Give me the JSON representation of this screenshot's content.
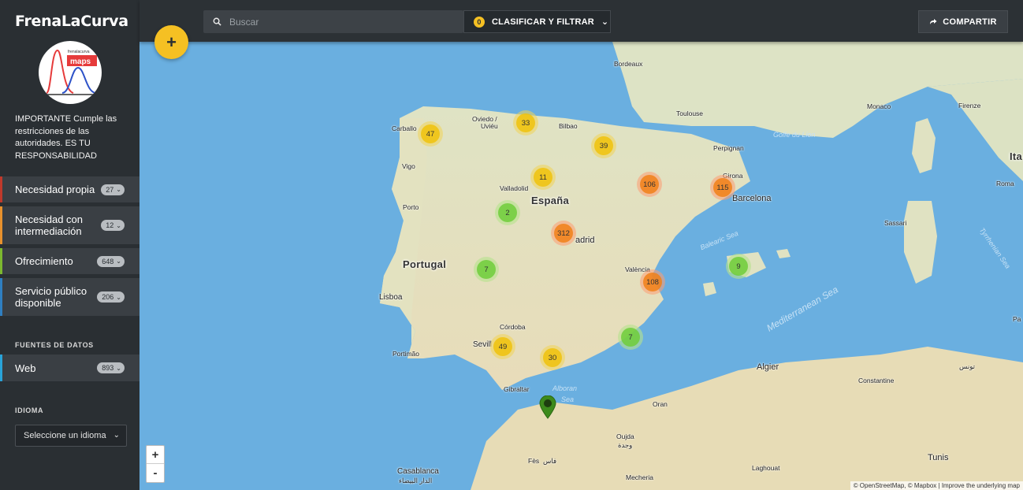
{
  "brand": "FrenaLaCurva",
  "logo": {
    "small_text": "frenalacurva",
    "big_text": "maps"
  },
  "notice": "IMPORTANTE Cumple las restricciones de las autoridades. ES TU RESPONSABILIDAD",
  "categories": [
    {
      "label": "Necesidad propia",
      "count": "27",
      "color": "#c0392b"
    },
    {
      "label": "Necesidad con intermediación",
      "count": "12",
      "color": "#e8912d"
    },
    {
      "label": "Ofrecimiento",
      "count": "648",
      "color": "#7cb82f"
    },
    {
      "label": "Servicio público disponible",
      "count": "206",
      "color": "#2f7fc1"
    }
  ],
  "sources": {
    "title": "FUENTES DE DATOS",
    "items": [
      {
        "label": "Web",
        "count": "893",
        "color": "#29a3d9"
      }
    ]
  },
  "language": {
    "title": "IDIOMA",
    "placeholder": "Seleccione un idioma"
  },
  "topbar": {
    "search_placeholder": "Buscar",
    "filter_count": "0",
    "filter_label": "CLASIFICAR Y FILTRAR",
    "share_label": "COMPARTIR"
  },
  "add_label": "+",
  "zoom": {
    "in": "+",
    "out": "-"
  },
  "attribution": "© OpenStreetMap, © Mapbox | Improve the underlying map",
  "clusters": [
    {
      "count": "47",
      "level": "y"
    },
    {
      "count": "33",
      "level": "y"
    },
    {
      "count": "39",
      "level": "y"
    },
    {
      "count": "11",
      "level": "y"
    },
    {
      "count": "106",
      "level": "o"
    },
    {
      "count": "115",
      "level": "o"
    },
    {
      "count": "2",
      "level": "g"
    },
    {
      "count": "312",
      "level": "o"
    },
    {
      "count": "7",
      "level": "g"
    },
    {
      "count": "9",
      "level": "g"
    },
    {
      "count": "108",
      "level": "o"
    },
    {
      "count": "7",
      "level": "g"
    },
    {
      "count": "49",
      "level": "y"
    },
    {
      "count": "30",
      "level": "y"
    }
  ],
  "countries": {
    "spain": "España",
    "portugal": "Portugal",
    "italy": "Ita"
  },
  "cities": [
    "Bordeaux",
    "Toulouse",
    "Monaco",
    "Firenze",
    "Roma",
    "Carballo",
    "Oviedo /",
    "Uviéu",
    "Bilbao",
    "Vigo",
    "Perpignan",
    "Girona",
    "Barcelona",
    "Valladolid",
    "Porto",
    "adrid",
    "València",
    "Lisboa",
    "Sassari",
    "Córdoba",
    "Sevill",
    "Portimão",
    "Algier",
    "تونس",
    "Constantine",
    "Gibraltar",
    "Oran",
    "Oujda",
    "وجدة",
    "Fès",
    "فاس",
    "Casablanca",
    "الدار البيضاء",
    "Mecheria",
    "Laghouat",
    "Pa",
    "Tunis"
  ],
  "seas": [
    "Golfe du Lion",
    "Balearic Sea",
    "Mediterranean Sea",
    "Tyrrhenian Sea",
    "Alboran",
    "Sea"
  ]
}
